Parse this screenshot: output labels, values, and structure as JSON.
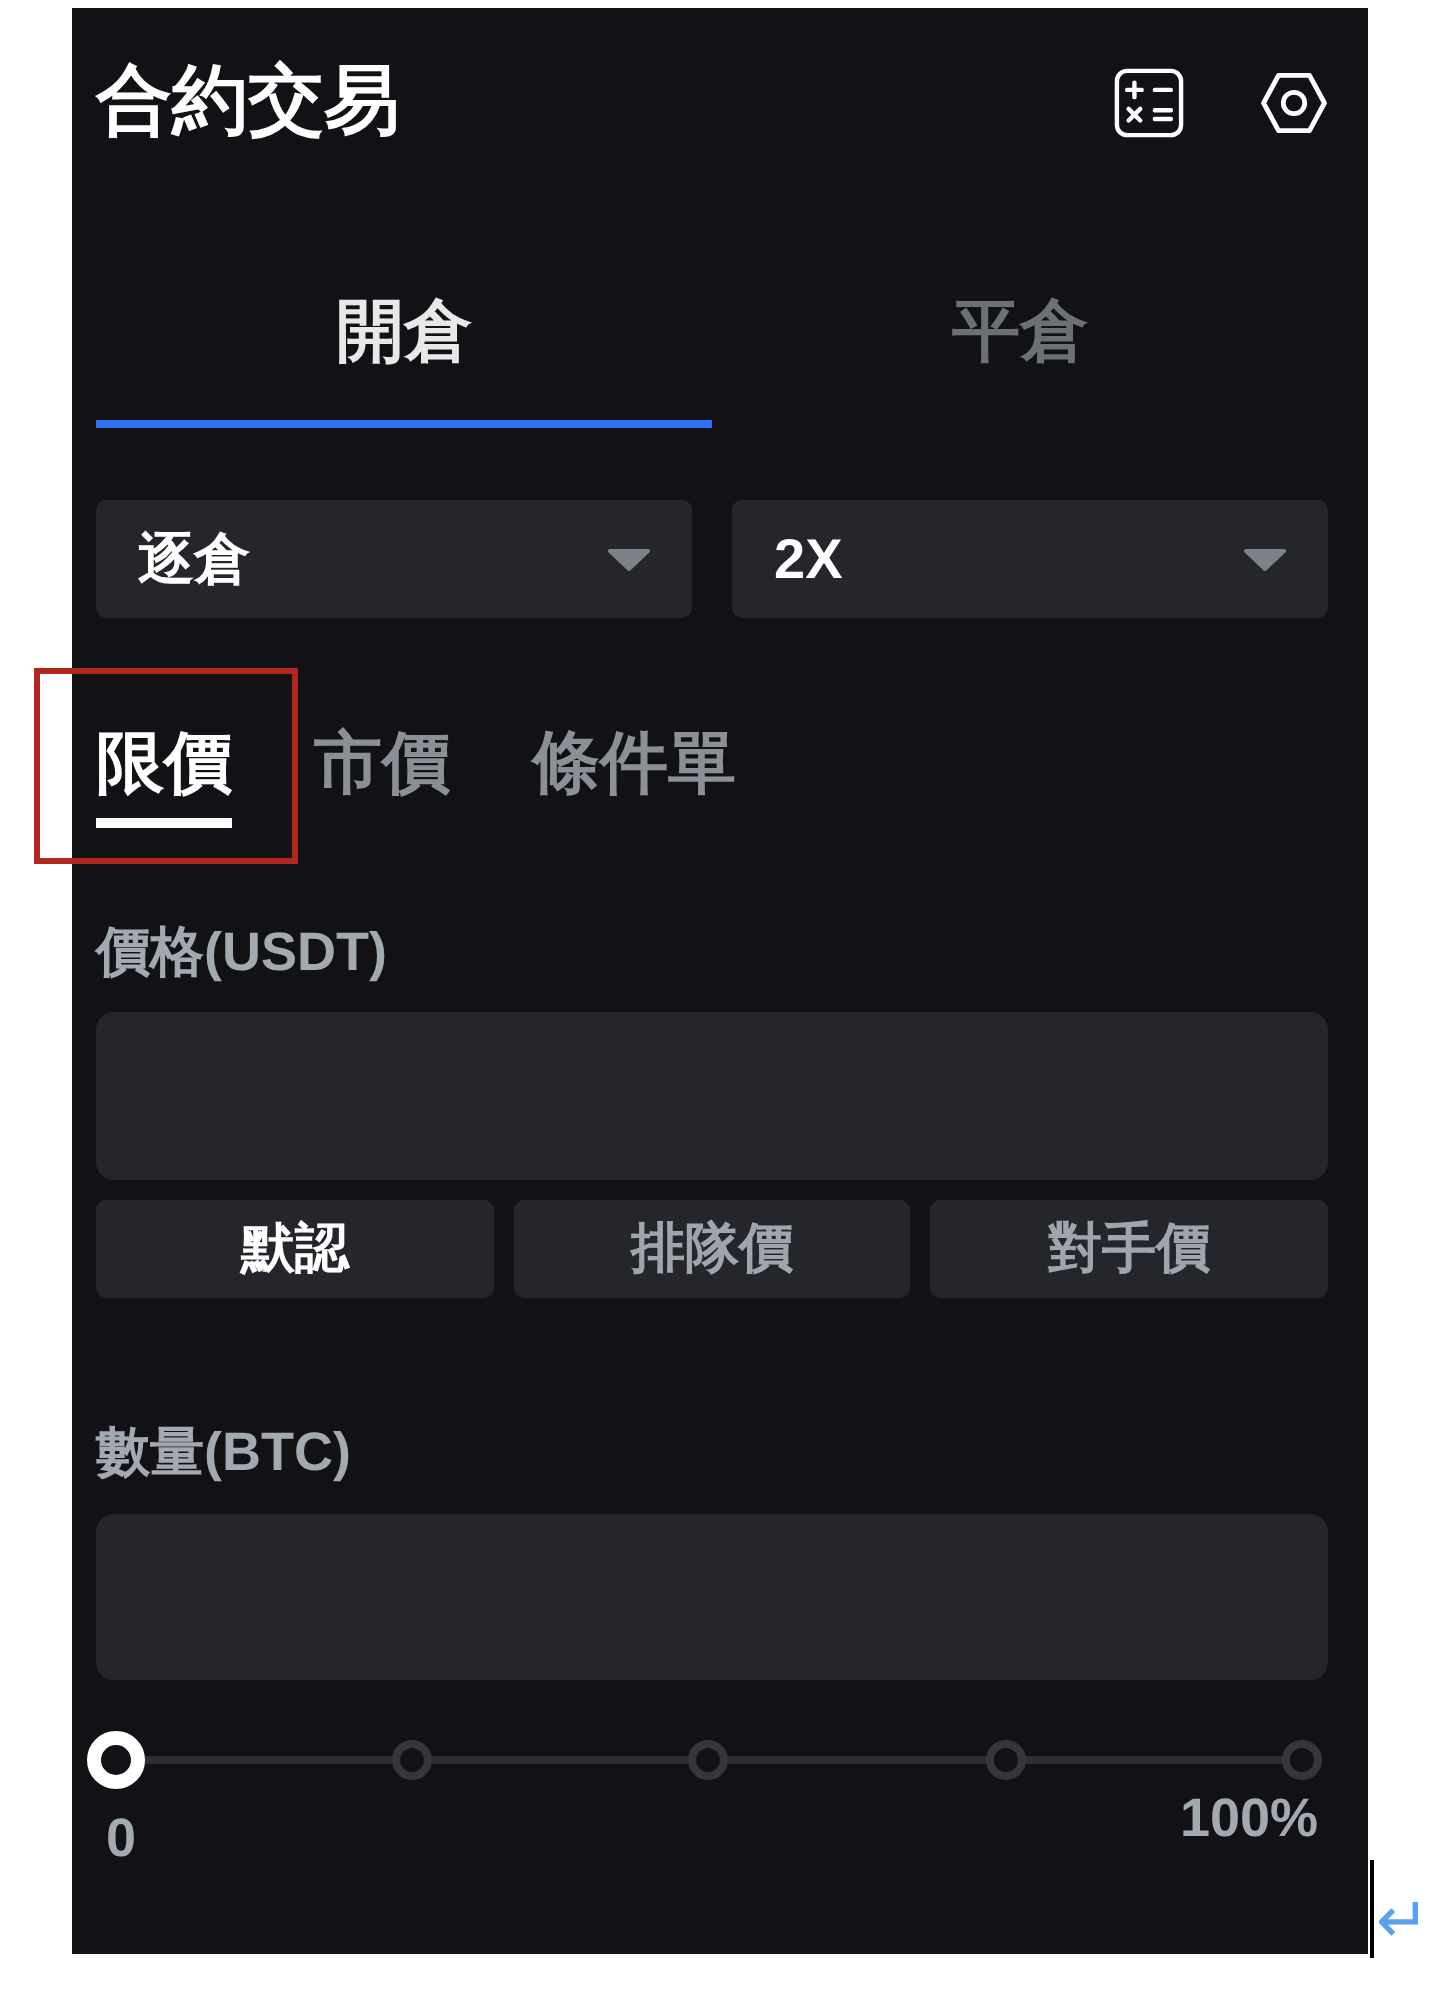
{
  "header": {
    "title": "合約交易"
  },
  "position_tabs": [
    {
      "label": "開倉",
      "selected": true
    },
    {
      "label": "平倉",
      "selected": false
    }
  ],
  "selects": [
    {
      "value": "逐倉"
    },
    {
      "value": "2X"
    }
  ],
  "order_types": [
    {
      "label": "限價",
      "selected": true,
      "highlighted": true
    },
    {
      "label": "市價",
      "selected": false,
      "highlighted": false
    },
    {
      "label": "條件單",
      "selected": false,
      "highlighted": false
    }
  ],
  "price": {
    "label": "價格(USDT)"
  },
  "price_options": [
    {
      "label": "默認",
      "selected": true
    },
    {
      "label": "排隊價",
      "selected": false
    },
    {
      "label": "對手價",
      "selected": false
    }
  ],
  "quantity": {
    "label": "數量(BTC)"
  },
  "slider": {
    "level": 0,
    "min_label": "0",
    "max_label": "100%"
  },
  "return_mark": "↵"
}
